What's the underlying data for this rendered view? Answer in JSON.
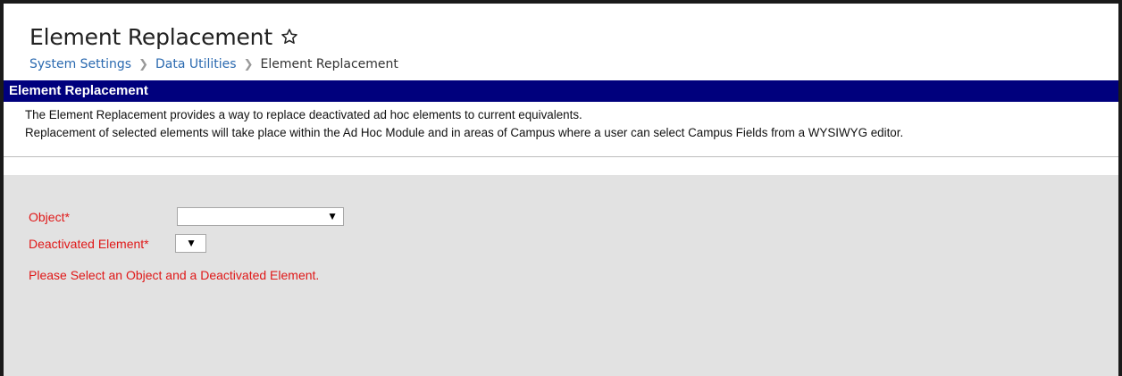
{
  "header": {
    "title": "Element Replacement",
    "breadcrumb": [
      {
        "label": "System Settings"
      },
      {
        "label": "Data Utilities"
      },
      {
        "label": "Element Replacement"
      }
    ]
  },
  "section": {
    "title": "Element Replacement",
    "description": [
      "The Element Replacement provides a way to replace deactivated ad hoc elements to current equivalents.",
      "Replacement of selected elements will take place within the Ad Hoc Module and in areas of Campus where a user can select Campus Fields from a WYSIWYG editor."
    ]
  },
  "form": {
    "object_label": "Object*",
    "object_value": "",
    "deactivated_label": "Deactivated Element*",
    "deactivated_value": "",
    "message": "Please Select an Object and a Deactivated Element."
  },
  "icons": {
    "favorite": "star-outline-icon",
    "dropdown": "triangle-down-icon"
  },
  "colors": {
    "section_bar": "#00007d",
    "link": "#2b6ab0",
    "required_text": "#e01818",
    "form_bg": "#e2e2e2"
  }
}
